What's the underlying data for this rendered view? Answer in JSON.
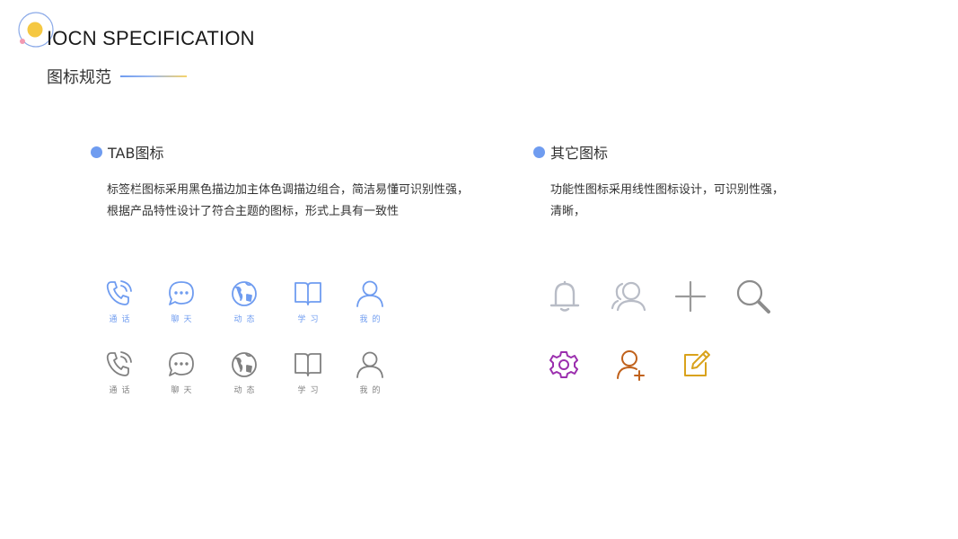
{
  "header": {
    "title": "IOCN SPECIFICATION",
    "subtitle": "图标规范"
  },
  "colors": {
    "accent_blue": "#6f9cf0",
    "logo_yellow": "#f5c842",
    "logo_pink": "#f29ab2",
    "icon_gray": "#808080",
    "light_gray": "#b8bcc6",
    "purple": "#9b2fae",
    "orange": "#c0611b",
    "gold": "#d9a21b"
  },
  "tab_section": {
    "heading": "TAB图标",
    "desc_line1": "标签栏图标采用黑色描边加主体色调描边组合，简洁易懂可识别性强，",
    "desc_line2": "根据产品特性设计了符合主题的图标，形式上具有一致性",
    "active_row": [
      {
        "icon": "phone-icon",
        "label": "通话"
      },
      {
        "icon": "chat-icon",
        "label": "聊天"
      },
      {
        "icon": "globe-icon",
        "label": "动态"
      },
      {
        "icon": "book-icon",
        "label": "学习"
      },
      {
        "icon": "user-icon",
        "label": "我的"
      }
    ],
    "inactive_row": [
      {
        "icon": "phone-icon",
        "label": "通话"
      },
      {
        "icon": "chat-icon",
        "label": "聊天"
      },
      {
        "icon": "globe-icon",
        "label": "动态"
      },
      {
        "icon": "book-icon",
        "label": "学习"
      },
      {
        "icon": "user-icon",
        "label": "我的"
      }
    ]
  },
  "other_section": {
    "heading": "其它图标",
    "desc_line1": "功能性图标采用线性图标设计，可识别性强，",
    "desc_line2": "清晰，",
    "icons": [
      "bell-icon",
      "users-icon",
      "plus-icon",
      "search-icon",
      "gear-icon",
      "add-user-icon",
      "edit-icon"
    ]
  }
}
